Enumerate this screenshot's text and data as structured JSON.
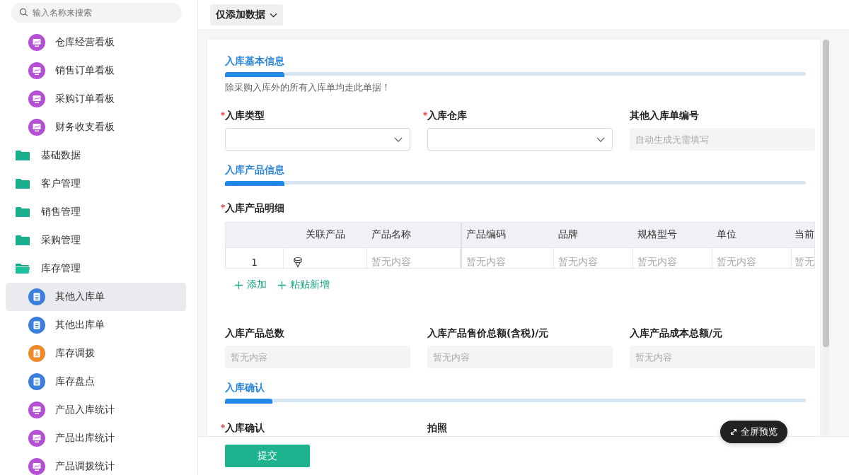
{
  "toolbar": {
    "mode_button": "仅添加数据"
  },
  "sidebar": {
    "search": {
      "placeholder": "输入名称来搜索"
    },
    "items": [
      {
        "label": "仓库经营看板",
        "kind": "board",
        "selected": false
      },
      {
        "label": "销售订单看板",
        "kind": "board",
        "selected": false
      },
      {
        "label": "采购订单看板",
        "kind": "board",
        "selected": false
      },
      {
        "label": "财务收支看板",
        "kind": "board",
        "selected": false
      }
    ],
    "folders": [
      {
        "label": "基础数据",
        "expanded": false
      },
      {
        "label": "客户管理",
        "expanded": false
      },
      {
        "label": "销售管理",
        "expanded": false
      },
      {
        "label": "采购管理",
        "expanded": false
      },
      {
        "label": "库存管理",
        "expanded": true,
        "children": [
          {
            "label": "其他入库单",
            "kind": "doc",
            "selected": true
          },
          {
            "label": "其他出库单",
            "kind": "doc",
            "selected": false
          },
          {
            "label": "库存调拨",
            "kind": "transfer",
            "selected": false
          },
          {
            "label": "库存盘点",
            "kind": "doc",
            "selected": false
          },
          {
            "label": "产品入库统计",
            "kind": "board",
            "selected": false
          },
          {
            "label": "产品出库统计",
            "kind": "board",
            "selected": false
          },
          {
            "label": "产品调拨统计",
            "kind": "board",
            "selected": false
          }
        ]
      }
    ]
  },
  "basic_info": {
    "title": "入库基本信息",
    "note": "除采购入库外的所有入库单均走此单据！",
    "fields": [
      {
        "label": "入库类型",
        "required": true,
        "kind": "select"
      },
      {
        "label": "入库仓库",
        "required": true,
        "kind": "select"
      },
      {
        "label": "其他入库单编号",
        "required": false,
        "kind": "readonly",
        "placeholder": "自动生成无需填写"
      }
    ]
  },
  "product_info": {
    "title": "入库产品信息",
    "table_label": "入库产品明细",
    "table_required": true,
    "columns": [
      {
        "label": "关联产品",
        "kind": "link"
      },
      {
        "label": "产品名称",
        "kind": "text"
      },
      {
        "label": "产品编码",
        "kind": "text"
      },
      {
        "label": "品牌",
        "kind": "text"
      },
      {
        "label": "规格型号",
        "kind": "text"
      },
      {
        "label": "单位",
        "kind": "text"
      },
      {
        "label": "当前",
        "kind": "text"
      }
    ],
    "rows": [
      {
        "index": "1",
        "cells": [
          "",
          "暂无内容",
          "暂无内容",
          "暂无内容",
          "暂无内容",
          "暂无内容",
          "暂无"
        ]
      }
    ],
    "actions": [
      "添加",
      "粘贴新增"
    ],
    "totals": [
      {
        "label": "入库产品总数",
        "required": false,
        "kind": "readonly",
        "placeholder": "暂无内容"
      },
      {
        "label": "入库产品售价总额(含税)/元",
        "required": false,
        "kind": "readonly",
        "placeholder": "暂无内容"
      },
      {
        "label": "入库产品成本总额/元",
        "required": false,
        "kind": "readonly",
        "placeholder": "暂无内容"
      }
    ]
  },
  "confirmation": {
    "title": "入库确认",
    "fields": [
      {
        "label": "入库确认",
        "required": true
      },
      {
        "label": "拍照",
        "required": false
      }
    ]
  },
  "footer": {
    "submit": "提交"
  },
  "fullscreen_button": "全屏预览"
}
